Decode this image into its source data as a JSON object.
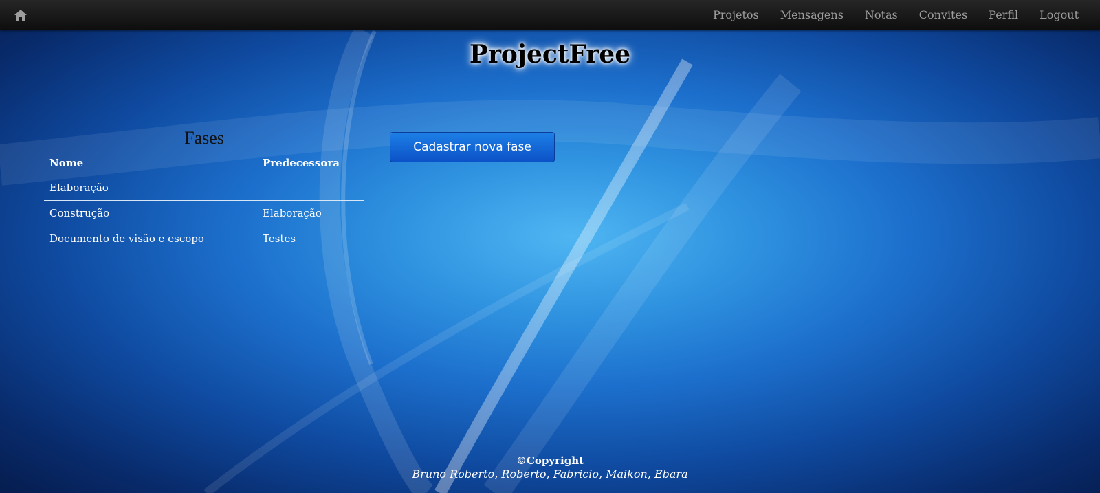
{
  "navbar": {
    "home_icon": "home-icon",
    "items": [
      {
        "label": "Projetos"
      },
      {
        "label": "Mensagens"
      },
      {
        "label": "Notas"
      },
      {
        "label": "Convites"
      },
      {
        "label": "Perfil"
      },
      {
        "label": "Logout"
      }
    ]
  },
  "page": {
    "title": "ProjectFree"
  },
  "phases": {
    "heading": "Fases",
    "columns": {
      "name": "Nome",
      "predecessor": "Predecessora"
    },
    "rows": [
      {
        "name": "Elaboração",
        "predecessor": ""
      },
      {
        "name": "Construção",
        "predecessor": "Elaboração"
      },
      {
        "name": "Documento de visão e escopo",
        "predecessor": "Testes"
      }
    ]
  },
  "actions": {
    "new_phase_label": "Cadastrar nova fase"
  },
  "footer": {
    "copyright": "©Copyright",
    "authors": "Bruno Roberto, Roberto, Fabricio, Maikon, Ebara"
  },
  "colors": {
    "navbar_bg": "#141414",
    "nav_text": "#9d9d9d",
    "button_bg": "#1565d8",
    "background_blue": "#1c6fcc"
  }
}
